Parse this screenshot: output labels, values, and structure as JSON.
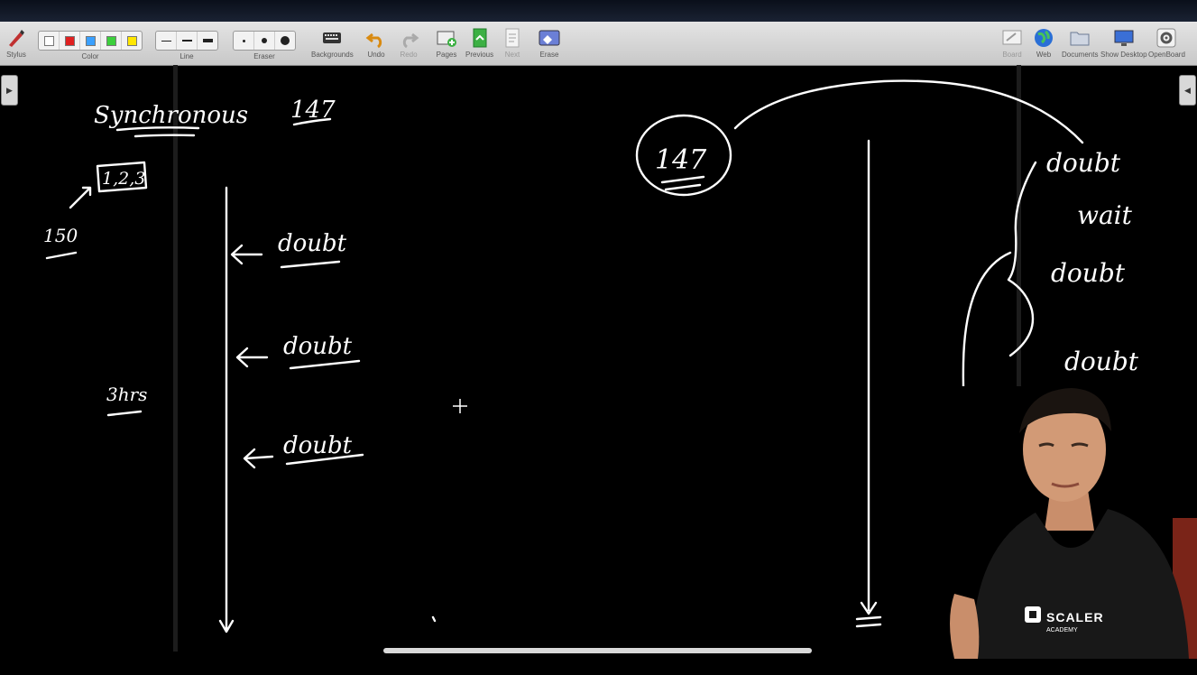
{
  "toolbar": {
    "stylus": "Stylus",
    "color": "Color",
    "line": "Line",
    "eraser": "Eraser",
    "backgrounds": "Backgrounds",
    "undo": "Undo",
    "redo": "Redo",
    "pages": "Pages",
    "previous": "Previous",
    "next": "Next",
    "erase": "Erase",
    "board": "Board",
    "web": "Web",
    "documents": "Documents",
    "show_desktop": "Show Desktop",
    "openboard": "OpenBoard",
    "colors": [
      "#ffffff",
      "#e02020",
      "#3aa0ff",
      "#3ccf3c",
      "#ffe600"
    ]
  },
  "board": {
    "synchronous": "Synchronous",
    "num_147_left": "147",
    "num_150": "150",
    "num_123": "1,2,3",
    "num_3hrs": "3hrs",
    "doubt_1": "doubt",
    "doubt_2": "doubt",
    "doubt_3": "doubt",
    "num_147_right": "147",
    "r_doubt_1": "doubt",
    "r_wait": "wait",
    "r_doubt_2": "doubt",
    "r_doubt_3": "doubt"
  },
  "webcam": {
    "shirt_brand": "SCALER",
    "shirt_sub": "ACADEMY"
  }
}
